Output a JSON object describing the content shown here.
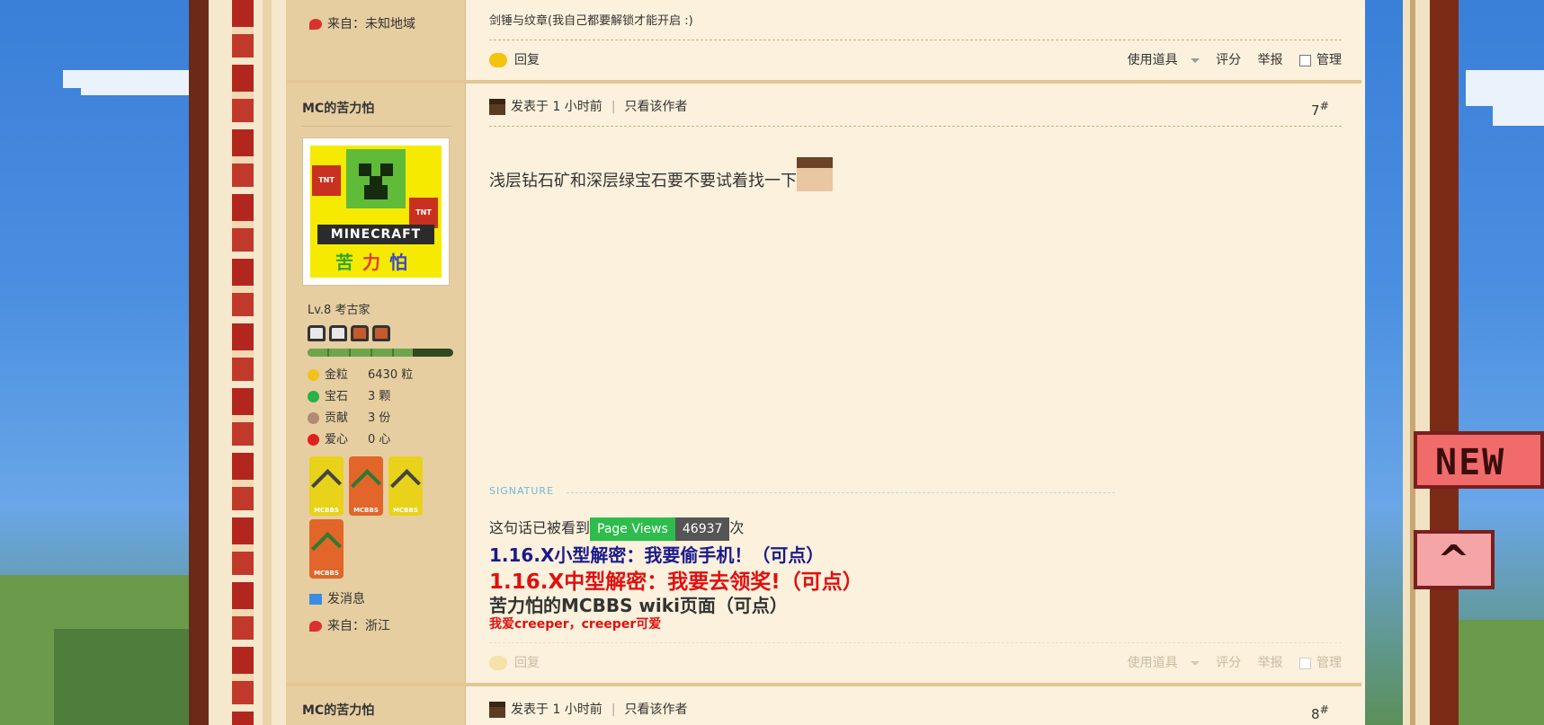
{
  "prev_post": {
    "from_label": "来自：未知地域",
    "snippet": "剑锤与纹章(我自己都要解锁才能开启 :)",
    "actions": {
      "reply": "回复",
      "use_item": "使用道具",
      "rate": "评分",
      "report": "举报",
      "manage": "管理"
    }
  },
  "post": {
    "author": "MC的苦力怕",
    "posted": "发表于 1 小时前",
    "only_author": "只看该作者",
    "floor": "7",
    "floor_suffix": "#",
    "content": "浅层钻石矿和深层绿宝石要不要试着找一下",
    "avatar": {
      "tnt": "TNT",
      "logo": "MINECRAFT",
      "c1": "苦",
      "c2": "力",
      "c3": "怕"
    },
    "level": "Lv.8 考古家",
    "xp_fraction": 0.72,
    "stats": [
      {
        "key": "金粒",
        "value": "6430 粒",
        "color": "#f2c21b"
      },
      {
        "key": "宝石",
        "value": "3 颗",
        "color": "#27b24a"
      },
      {
        "key": "贡献",
        "value": "3 份",
        "color": "#b38a74"
      },
      {
        "key": "爱心",
        "value": "0 心",
        "color": "#e02020"
      }
    ],
    "medal_label": "MCBBS",
    "send_message": "发消息",
    "from_label": "来自：浙江",
    "signature": {
      "label": "SIGNATURE",
      "seen_prefix": "这句话已被看到",
      "pv_label": "Page Views",
      "pv_value": "46937",
      "seen_suffix": "次",
      "line1": "1.16.X小型解密：我要偷手机！（可点）",
      "line2": "1.16.X中型解密：我要去领奖!（可点）",
      "line3": "苦力怕的MCBBS wiki页面（可点）",
      "line4": "我爱creeper，creeper可爱"
    },
    "actions": {
      "reply": "回复",
      "use_item": "使用道具",
      "rate": "评分",
      "report": "举报",
      "manage": "管理"
    }
  },
  "next_post": {
    "author": "MC的苦力怕",
    "posted": "发表于 1 小时前",
    "only_author": "只看该作者",
    "floor": "8",
    "floor_suffix": "#"
  },
  "badges": {
    "new": "NEW",
    "top": "^"
  }
}
